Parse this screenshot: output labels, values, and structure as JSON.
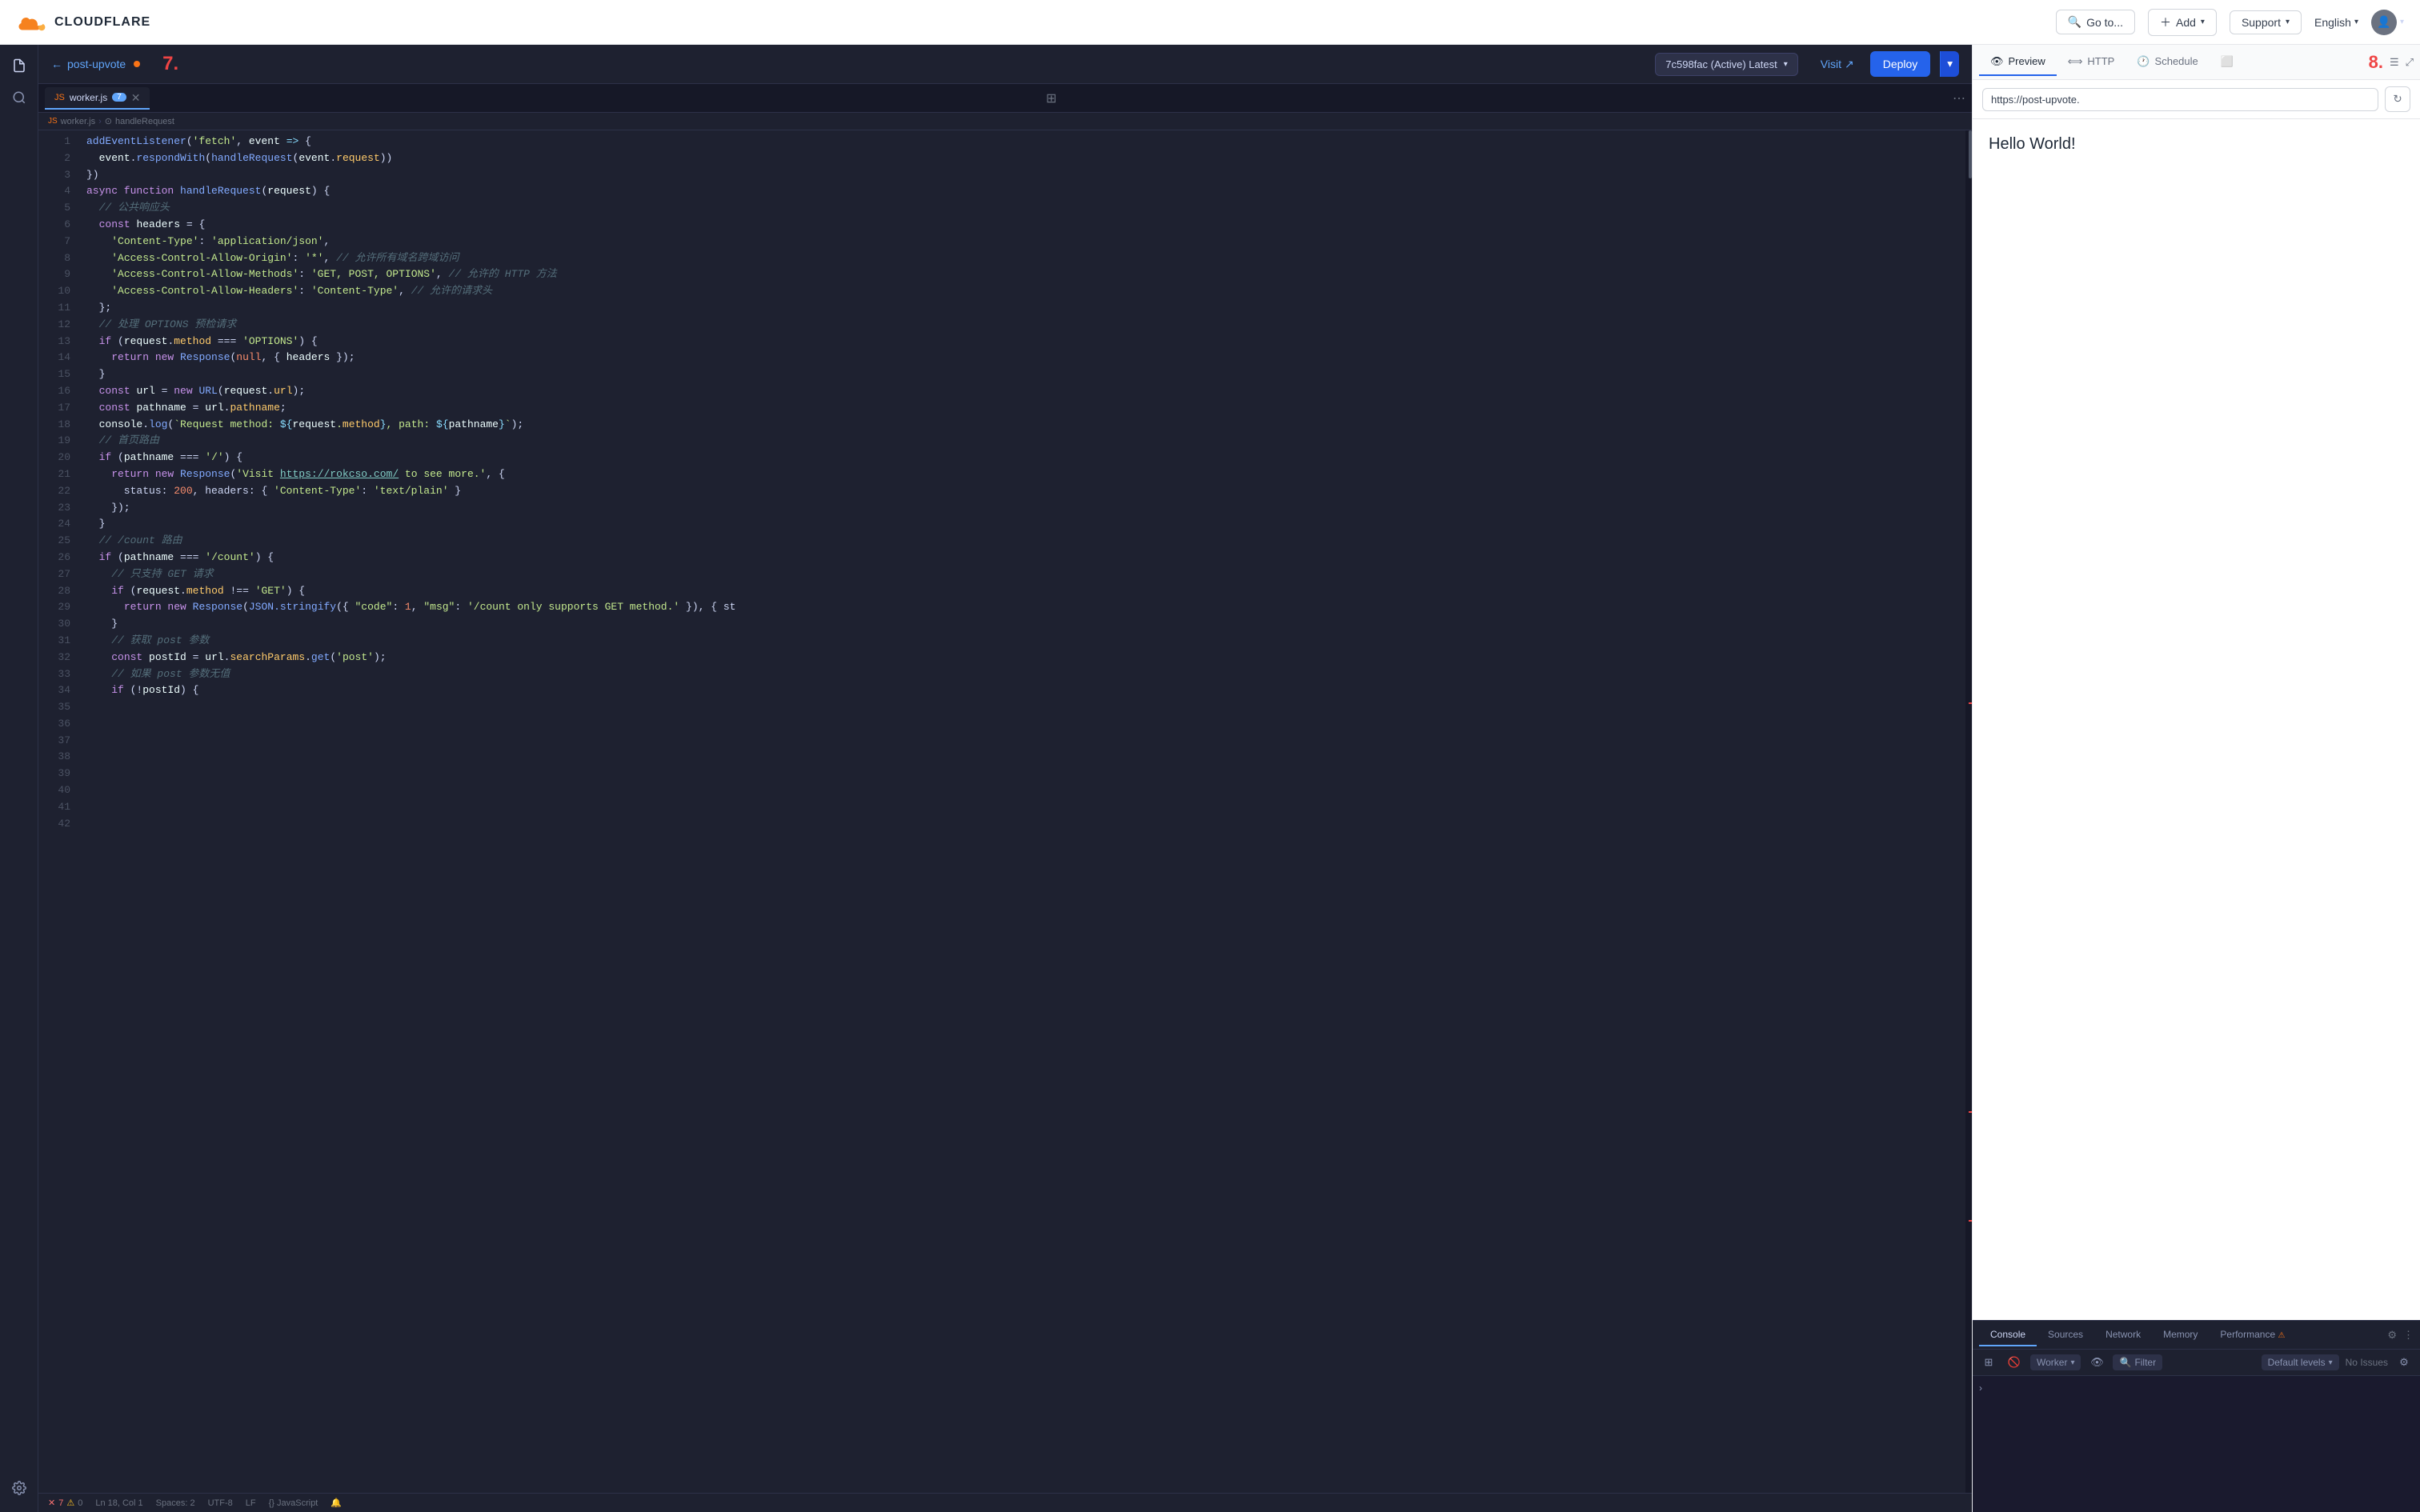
{
  "nav": {
    "logo_text": "CLOUDFLARE",
    "go_to_label": "Go to...",
    "add_label": "Add",
    "support_label": "Support",
    "lang_label": "English",
    "visit_label": "Visit"
  },
  "editor": {
    "back_label": "post-upvote",
    "step_left": "7.",
    "step_right": "8.",
    "version_label": "7c598fac (Active) Latest",
    "deploy_label": "Deploy",
    "tab_label": "worker.js",
    "tab_badge": "7",
    "breadcrumb_file": "worker.js",
    "breadcrumb_fn": "handleRequest",
    "status_line": "Ln 18, Col 1",
    "status_spaces": "Spaces: 2",
    "status_encoding": "UTF-8",
    "status_eol": "LF",
    "status_lang": "{} JavaScript",
    "status_errors": "7",
    "status_warnings": "0"
  },
  "code": {
    "lines": [
      "addEventListener('fetch', event => {",
      "  event.respondWith(handleRequest(event.request))",
      "})",
      "",
      "async function handleRequest(request) {",
      "  // 公共响应头",
      "  const headers = {",
      "    'Content-Type': 'application/json',",
      "    'Access-Control-Allow-Origin': '*', // 允许所有域名跨域访问",
      "    'Access-Control-Allow-Methods': 'GET, POST, OPTIONS', // 允许的 HTTP 方法",
      "    'Access-Control-Allow-Headers': 'Content-Type', // 允许的请求头",
      "  };",
      "",
      "  // 处理 OPTIONS 预检请求",
      "  if (request.method === 'OPTIONS') {",
      "    return new Response(null, { headers });",
      "  }",
      "",
      "  const url = new URL(request.url);",
      "  const pathname = url.pathname;",
      "",
      "  console.log(`Request method: ${request.method}, path: ${pathname}`);",
      "",
      "  // 首页路由",
      "  if (pathname === '/') {",
      "    return new Response('Visit https://rokcso.com/ to see more.', {",
      "      status: 200, headers: { 'Content-Type': 'text/plain' }",
      "    });",
      "  }",
      "",
      "  // /count 路由",
      "  if (pathname === '/count') {",
      "    // 只支持 GET 请求",
      "    if (request.method !== 'GET') {",
      "      return new Response(JSON.stringify({ \"code\": 1, \"msg\": '/count only supports GET method.' }), { st",
      "    }",
      "",
      "    // 获取 post 参数",
      "    const postId = url.searchParams.get('post');",
      "",
      "    // 如果 post 参数无值",
      "    if (!postId) {"
    ]
  },
  "preview": {
    "tab_preview": "Preview",
    "tab_http": "HTTP",
    "tab_schedule": "Schedule",
    "url_value": "https://post-upvote.",
    "hello_world": "Hello World!",
    "visit_label": "Visit"
  },
  "devtools": {
    "tab_console": "Console",
    "tab_sources": "Sources",
    "tab_network": "Network",
    "tab_memory": "Memory",
    "tab_performance": "Performance",
    "worker_label": "Worker",
    "filter_label": "Filter",
    "levels_label": "Default levels",
    "no_issues_label": "No Issues"
  }
}
